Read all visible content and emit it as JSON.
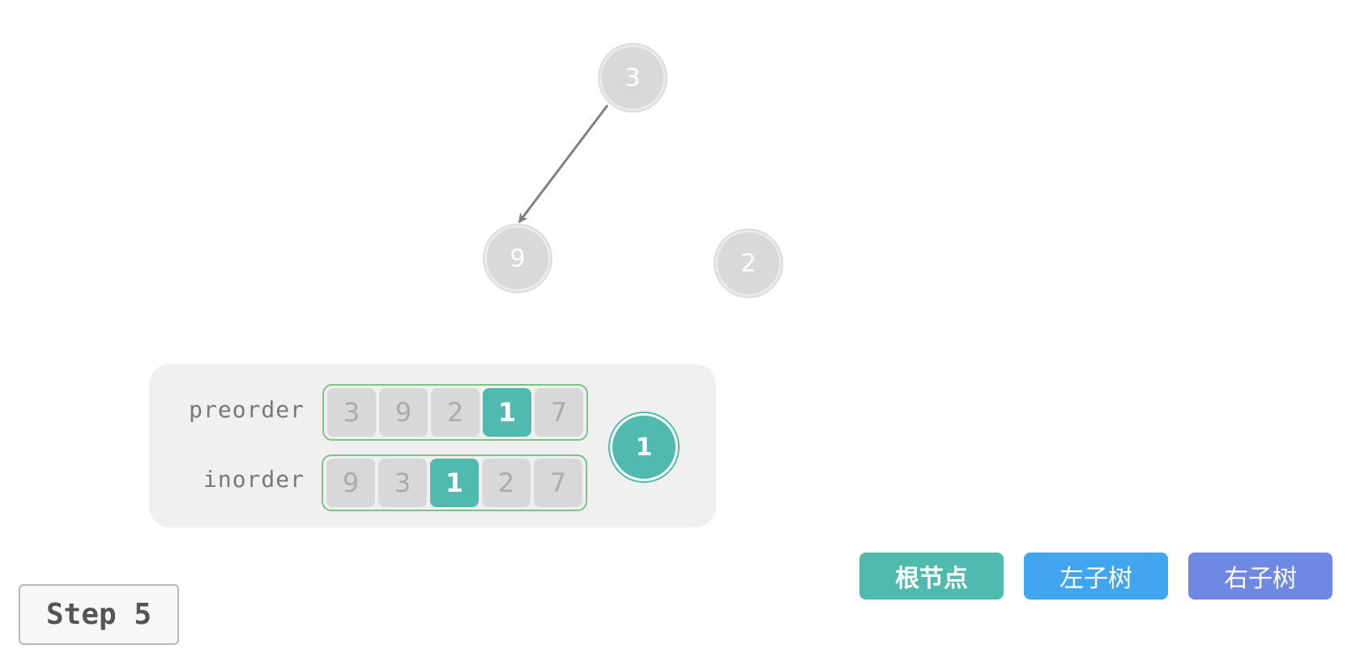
{
  "tree": {
    "nodes": [
      {
        "id": "n3",
        "label": "3"
      },
      {
        "id": "n9",
        "label": "9"
      },
      {
        "id": "n2",
        "label": "2"
      }
    ],
    "edges": [
      {
        "from": "3",
        "to": "9"
      }
    ]
  },
  "panel": {
    "preorder": {
      "label": "preorder",
      "values": [
        "3",
        "9",
        "2",
        "1",
        "7"
      ],
      "highlight_index": 3
    },
    "inorder": {
      "label": "inorder",
      "values": [
        "9",
        "3",
        "1",
        "2",
        "7"
      ],
      "highlight_index": 2
    },
    "root_value": "1"
  },
  "legend": {
    "root": {
      "label": "根节点",
      "color": "#4fbaad"
    },
    "left": {
      "label": "左子树",
      "color": "#42a5f0"
    },
    "right": {
      "label": "右子树",
      "color": "#6f88e4"
    }
  },
  "step_label": "Step 5",
  "colors": {
    "node_fill": "#d9d9d9",
    "highlight": "#4fbaad",
    "array_border": "#7cc286",
    "edge": "#808080"
  }
}
